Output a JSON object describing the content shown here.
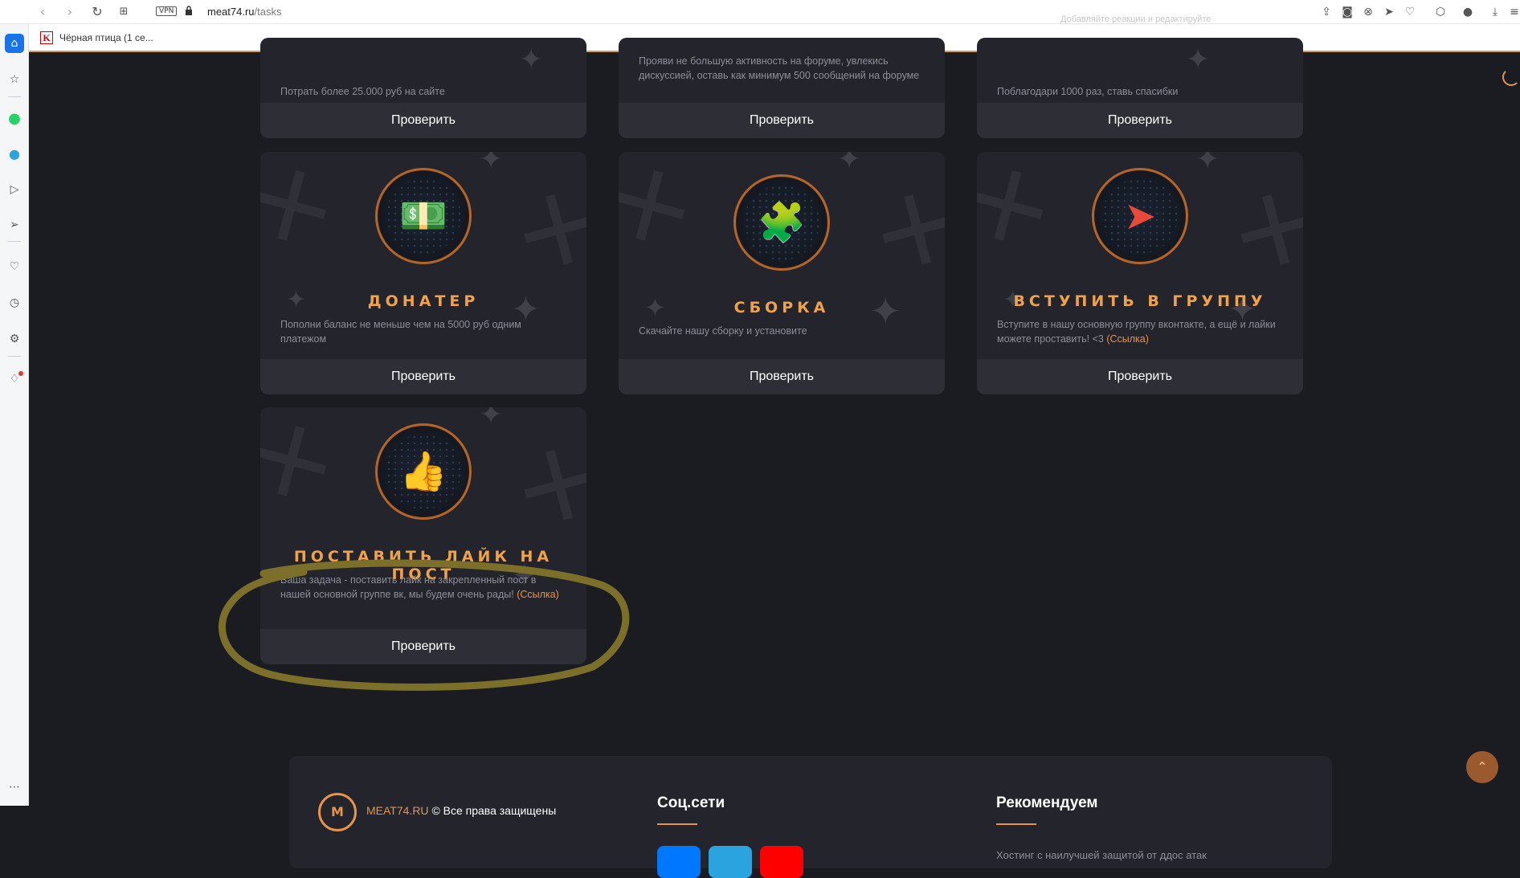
{
  "browser": {
    "vpn_label": "VPN",
    "url_host": "meat74.ru",
    "url_path": "/tasks",
    "ghost_text": "Добавляйте реакции и редактируйте",
    "bookmark_label": "Чёрная птица (1 се...",
    "bookmark_icon_letter": "K"
  },
  "top_cards": [
    {
      "desc": "Потрать более 25.000 руб на сайте",
      "button": "Проверить"
    },
    {
      "desc": "Прояви не большую активность на форуме, увлекись дискуссией, оставь как минимум 500 сообщений на форуме",
      "button": "Проверить"
    },
    {
      "desc": "Поблагодари 1000 раз, ставь спасибки",
      "button": "Проверить"
    }
  ],
  "cards": [
    {
      "title": "ДОНАТЕР",
      "desc": "Пополни баланс не меньше чем на 5000 руб одним платежом",
      "button": "Проверить",
      "icon": "money-icon"
    },
    {
      "title": "СБОРКА",
      "desc": "Скачайте нашу сборку и установите",
      "button": "Проверить",
      "icon": "puzzle-icon"
    },
    {
      "title": "ВСТУПИТЬ В ГРУППУ",
      "desc": "Вступите в нашу основную группу вконтакте, а ещё и лайки можете проставить! <3",
      "link": "(Ссылка)",
      "button": "Проверить",
      "icon": "arrow-pointer-icon"
    },
    {
      "title": "ПОСТАВИТЬ ЛАЙК НА ПОСТ",
      "desc": "Ваша задача - поставить лайк на закрепленный пост в нашей основной группе вк, мы будем очень рады!",
      "link": "(Ссылка)",
      "button": "Проверить",
      "icon": "thumbs-up-icon"
    }
  ],
  "footer": {
    "brand": "MEAT74.RU",
    "rights": "© Все права защищены",
    "social_heading": "Соц.сети",
    "recommend_heading": "Рекомендуем",
    "recommend_text": "Хостинг с наилучшей защитой от ддос атак"
  },
  "colors": {
    "accent": "#e5944a",
    "card_bg": "#24252c",
    "page_bg": "#1b1c21",
    "highlight_oval": "#7c6f2a"
  }
}
